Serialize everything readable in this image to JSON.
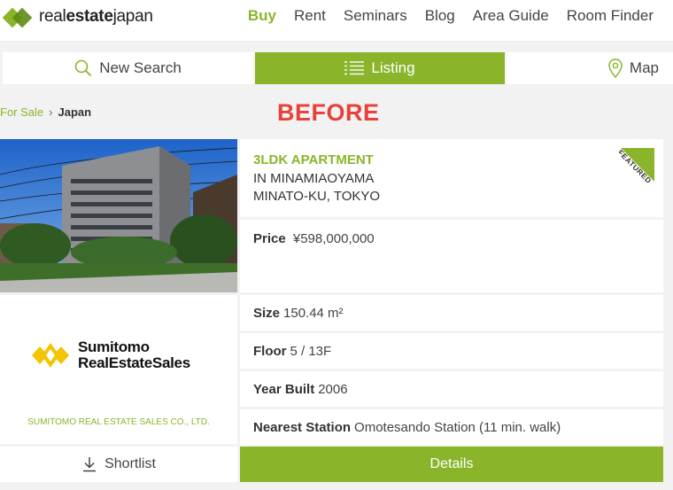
{
  "header": {
    "logo_text_prefix": "real",
    "logo_text_bold": "estate",
    "logo_text_suffix": "japan",
    "nav": [
      "Buy",
      "Rent",
      "Seminars",
      "Blog",
      "Area Guide",
      "Room Finder"
    ],
    "active_nav": "Buy"
  },
  "tabs": {
    "new_search": "New Search",
    "listing": "Listing",
    "map": "Map",
    "active": "Listing"
  },
  "breadcrumb": {
    "link": "For Sale",
    "separator": "›",
    "current": "Japan"
  },
  "overlay_label": "BEFORE",
  "listing": {
    "title": "3LDK APARTMENT",
    "subtitle_1": "IN MINAMIAOYAMA",
    "subtitle_2": "MINATO-KU, TOKYO",
    "badge": "FEATURED",
    "price_label": "Price",
    "price_value": "¥598,000,000",
    "size_label": "Size",
    "size_value": "150.44 m²",
    "floor_label": "Floor",
    "floor_value": "5 / 13F",
    "year_label": "Year Built",
    "year_value": "2006",
    "station_label": "Nearest Station",
    "station_value": "Omotesando Station (11 min. walk)"
  },
  "agent": {
    "logo_line_1": "Sumitomo",
    "logo_line_2": "RealEstateSales",
    "caption": "SUMITOMO REAL ESTATE SALES CO., LTD."
  },
  "actions": {
    "shortlist": "Shortlist",
    "details": "Details"
  },
  "colors": {
    "accent": "#8ab52a",
    "overlay_red": "#e8413a",
    "agent_logo_yellow": "#f5c400"
  }
}
